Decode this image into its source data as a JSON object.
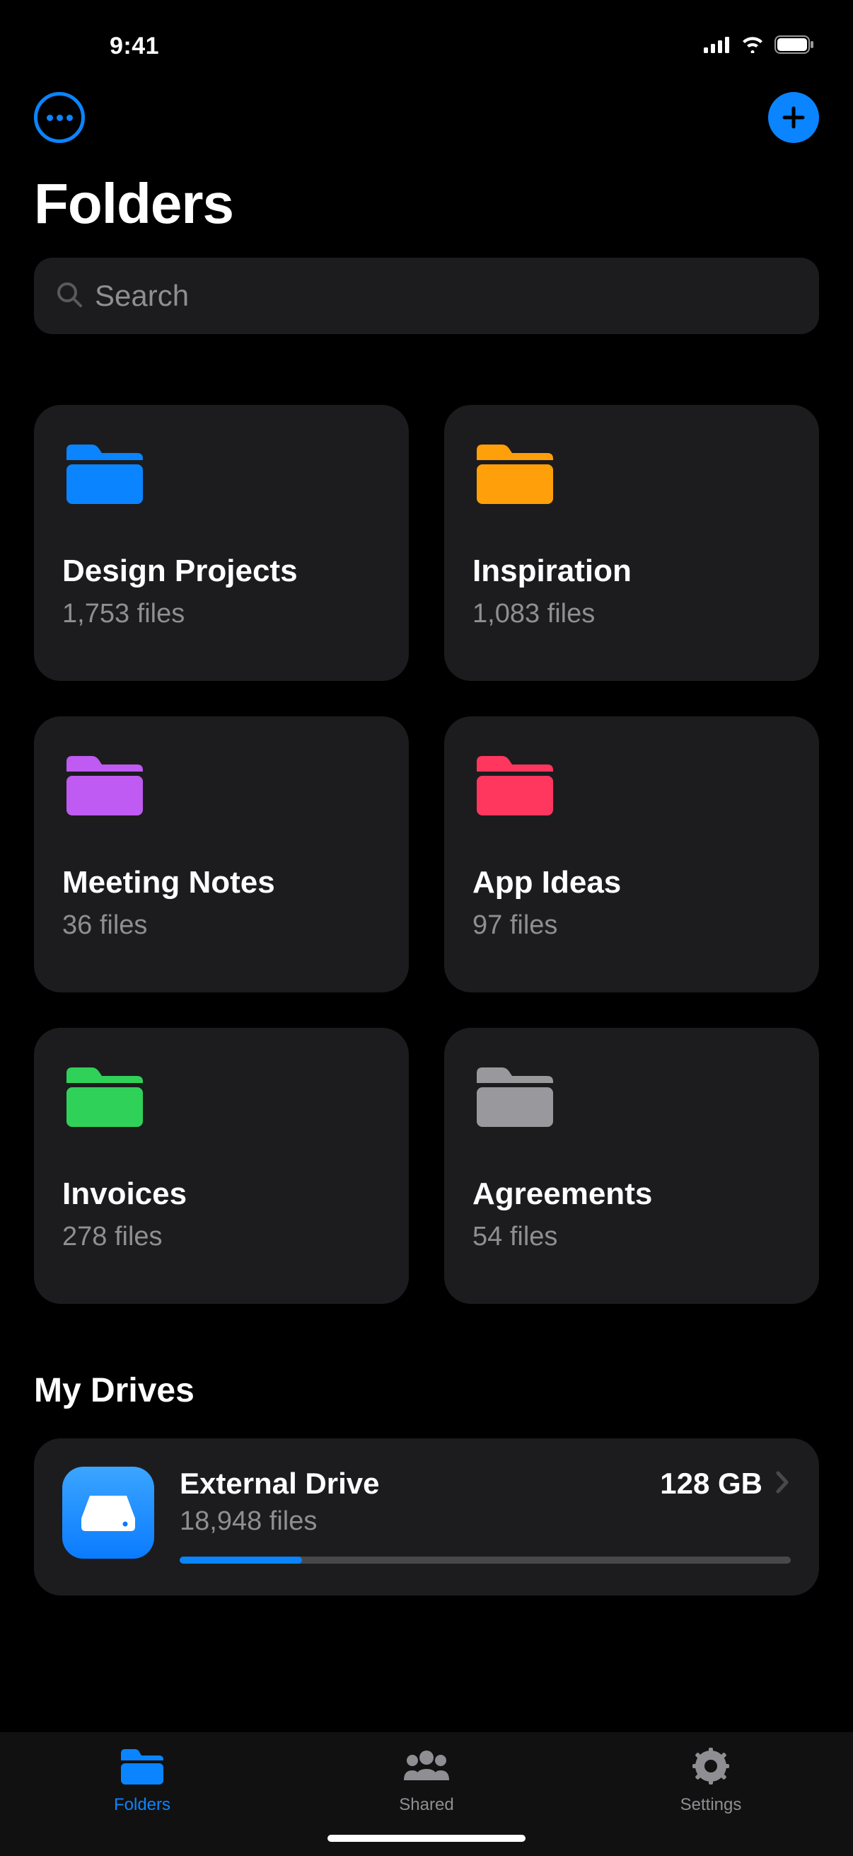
{
  "status": {
    "time": "9:41"
  },
  "header": {
    "title": "Folders"
  },
  "search": {
    "placeholder": "Search"
  },
  "folders": [
    {
      "name": "Design Projects",
      "count": "1,753 files",
      "color": "#0a84ff"
    },
    {
      "name": "Inspiration",
      "count": "1,083 files",
      "color": "#ff9f0a"
    },
    {
      "name": "Meeting Notes",
      "count": "36 files",
      "color": "#bf5af2"
    },
    {
      "name": "App Ideas",
      "count": "97 files",
      "color": "#ff375f"
    },
    {
      "name": "Invoices",
      "count": "278 files",
      "color": "#30d158"
    },
    {
      "name": "Agreements",
      "count": "54 files",
      "color": "#98989d"
    }
  ],
  "drives": {
    "section_title": "My Drives",
    "items": [
      {
        "name": "External Drive",
        "capacity": "128 GB",
        "files": "18,948 files",
        "usage_percent": 20
      }
    ]
  },
  "tabs": [
    {
      "label": "Folders",
      "active": true
    },
    {
      "label": "Shared",
      "active": false
    },
    {
      "label": "Settings",
      "active": false
    }
  ]
}
